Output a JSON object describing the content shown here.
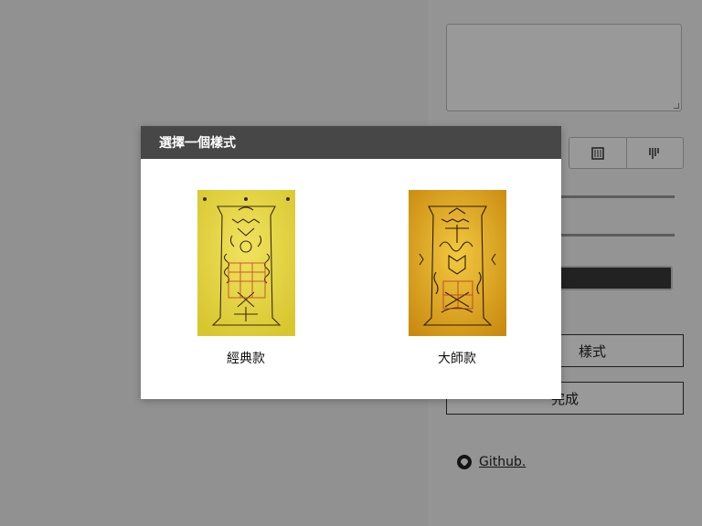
{
  "right_panel": {
    "btn_choose_style_partial": "樣式",
    "btn_done_partial": "完成",
    "github_label": "Github."
  },
  "modal": {
    "title": "選擇一個樣式",
    "options": [
      {
        "label": "經典款",
        "bg": "#e8d83a"
      },
      {
        "label": "大師款",
        "bg": "#e6ad22"
      }
    ]
  },
  "colors": {
    "header_bg": "#474747",
    "overlay": "rgba(0,0,0,0.40)",
    "ink": "#3a2a1a",
    "seal_red": "#c0392b"
  }
}
